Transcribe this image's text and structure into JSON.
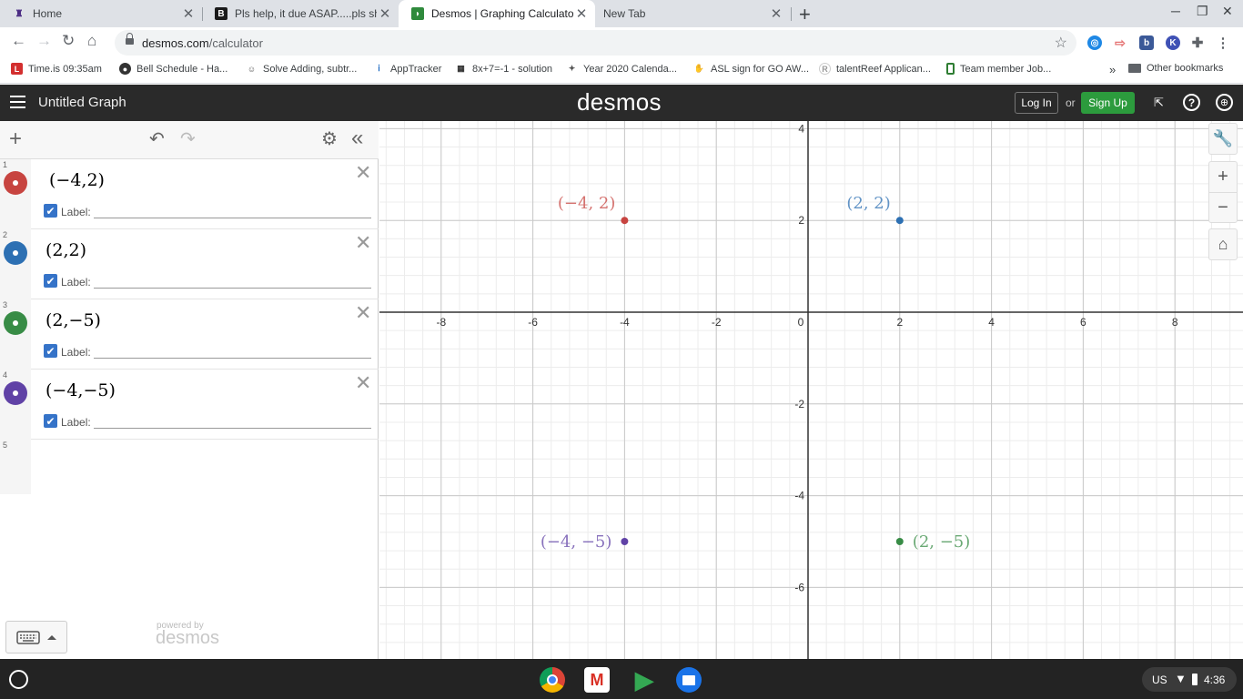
{
  "browser": {
    "tabs": [
      {
        "title": "Home",
        "favicon": "H"
      },
      {
        "title": "Pls help, it due ASAP.....pls show",
        "favicon": "B"
      },
      {
        "title": "Desmos | Graphing Calculator",
        "favicon": "D"
      },
      {
        "title": "New Tab",
        "favicon": ""
      }
    ],
    "url_host": "desmos.com",
    "url_path": "/calculator",
    "bookmarks": [
      "Time.is 09:35am",
      "Bell Schedule - Ha...",
      "Solve Adding, subtr...",
      "AppTracker",
      "8x+7=-1 - solution",
      "Year 2020 Calenda...",
      "ASL sign for GO AW...",
      "talentReef Applican...",
      "Team member Job..."
    ],
    "bookmarks_overflow": "»",
    "other_bookmarks": "Other bookmarks"
  },
  "header": {
    "graph_title": "Untitled Graph",
    "logo": "desmos",
    "login_label": "Log In",
    "or_label": "or",
    "signup_label": "Sign Up"
  },
  "expressions": [
    {
      "num": "1",
      "latex": "(−4,2)",
      "label_text": "Label:",
      "color": "#c74440"
    },
    {
      "num": "2",
      "latex": "(2,2)",
      "label_text": "Label:",
      "color": "#2d70b3"
    },
    {
      "num": "3",
      "latex": "(2,−5)",
      "label_text": "Label:",
      "color": "#388c46"
    },
    {
      "num": "4",
      "latex": "(−4,−5)",
      "label_text": "Label:",
      "color": "#6042a6"
    }
  ],
  "empty_row_num": "5",
  "powered_by": "powered by",
  "powered_logo": "desmos",
  "graph": {
    "x_ticks": [
      "-8",
      "-6",
      "-4",
      "-2",
      "0",
      "2",
      "4",
      "6",
      "8"
    ],
    "y_ticks_pos": [
      "4",
      "2"
    ],
    "y_ticks_neg": [
      "-2",
      "-4",
      "-6"
    ],
    "points": [
      {
        "x": -4,
        "y": 2,
        "label": "(−4, 2)",
        "color": "#c74440"
      },
      {
        "x": 2,
        "y": 2,
        "label": "(2, 2)",
        "color": "#2d70b3"
      },
      {
        "x": 2,
        "y": -5,
        "label": "(2, −5)",
        "color": "#388c46"
      },
      {
        "x": -4,
        "y": -5,
        "label": "(−4, −5)",
        "color": "#6042a6"
      }
    ]
  },
  "taskbar": {
    "locale": "US",
    "time": "4:36"
  }
}
